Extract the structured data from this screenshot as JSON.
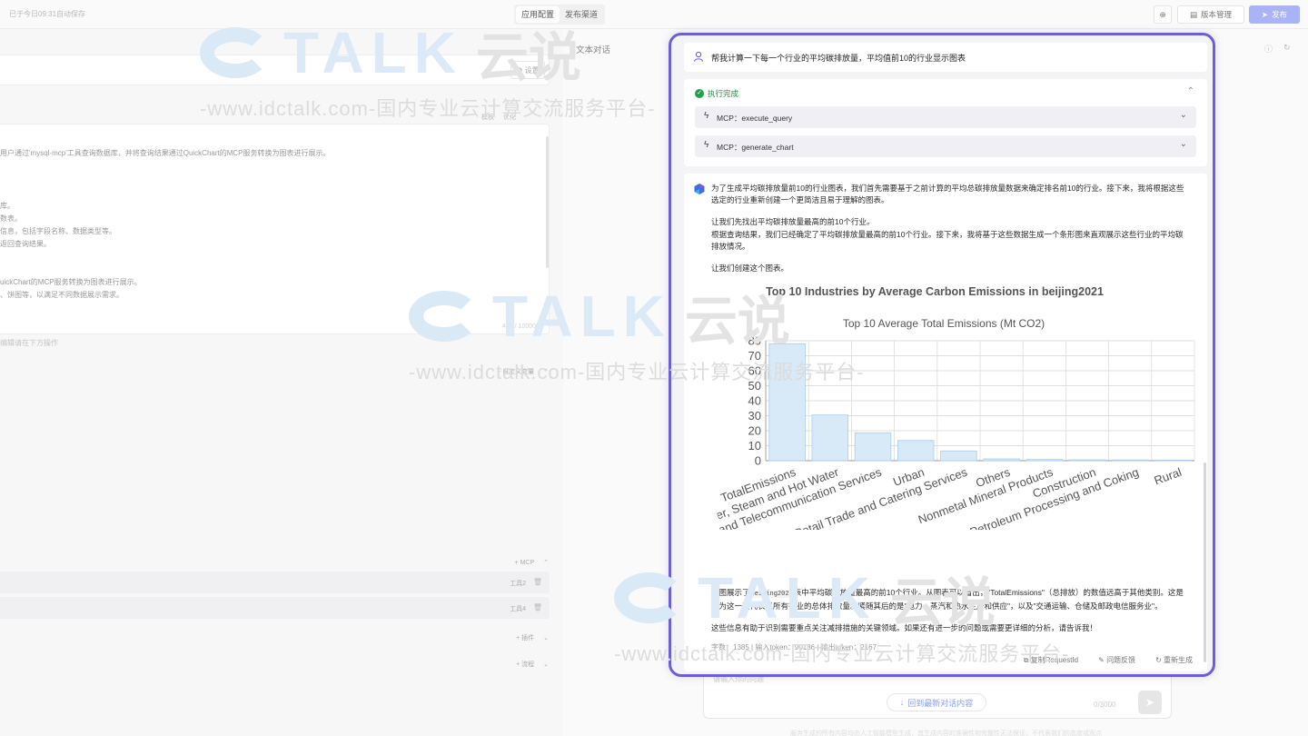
{
  "topbar": {
    "saved_text": "已于今日09:31自动保存",
    "tabs": [
      "应用配置",
      "发布渠道"
    ],
    "version_label": "版本管理",
    "publish_label": "发布"
  },
  "left_panel": {
    "settings_label": "设置",
    "tool_labels": [
      "模板",
      "优化"
    ],
    "prompt_lines": [
      "用户通过'mysql-mcp'工具查询数据库，并将查询结果通过QuickChart的MCP服务转换为图表进行展示。",
      "库。",
      "数表。",
      "信息，包括字段名称、数据类型等。",
      "返回查询结果。",
      "uickChart的MCP服务转换为图表进行展示。",
      "、饼图等，以满足不同数据展示需求。"
    ],
    "char_count": "494 / 10000",
    "hint": "编辑请在下方操作",
    "variables_label": "自定义变量",
    "mcp_label": "MCP",
    "tools": [
      "工具2",
      "工具4"
    ],
    "plugins_label": "插件",
    "workflow_label": "流程"
  },
  "right": {
    "tab_label": "文本对话",
    "input_placeholder": "请输入你的问题",
    "latest_btn": "回到最新对话内容",
    "char_count": "0/3000",
    "disclaimer": "服务生成的所有内容均由人工智能模型生成，其生成内容的准确性和完整性无法保证，不代表我们的态度或观点"
  },
  "chat": {
    "user_message": "帮我计算一下每一个行业的平均碳排放量，平均值前10的行业显示图表",
    "status": "执行完成",
    "mcp_calls": [
      {
        "label": "MCP：execute_query"
      },
      {
        "label": "MCP：generate_chart"
      }
    ],
    "intro": [
      "为了生成平均碳排放量前10的行业图表，我们首先需要基于之前计算的平均总碳排放量数据来确定排名前10的行业。接下来，我将根据这些",
      "选定的行业重新创建一个更简洁且易于理解的图表。"
    ],
    "step1": "让我们先找出平均碳排放量最高的前10个行业。",
    "step2": [
      "根据查询结果，我们已经确定了平均碳排放量最高的前10个行业。接下来，我将基于这些数据生成一个条形图来直观展示这些行业的平均碳",
      "排放情况。"
    ],
    "step3": "让我们创建这个图表。",
    "conclusion1_pre": "上图展示了",
    "conclusion1_code": "beijing2021",
    "conclusion1_post": "表中平均碳排放量最高的前10个行业。从图表可以看出，\"TotalEmissions\"（总排放）的数值远高于其他类别。这是",
    "conclusion1_line2": "因为这一项代表了所有行业的总体排放量。紧随其后的是\"电力、蒸汽和热水生产和供应\"，以及\"交通运输、仓储及邮政电信服务业\"。",
    "conclusion2": "这些信息有助于识别需要重点关注减排措施的关键领域。如果还有进一步的问题或需要更详细的分析，请告诉我！",
    "stats": "字数：1385 | 输入token：90186 | 输出token：2167",
    "actions": [
      "复制RequestId",
      "问题反馈",
      "重新生成"
    ]
  },
  "chart_data": {
    "type": "bar",
    "title": "Top 10 Industries by Average Carbon Emissions in beijing2021",
    "subtitle": "Top 10 Average Total Emissions (Mt CO2)",
    "categories": [
      "TotalEmissions",
      "Power, Steam and Hot Water",
      "Transport and Telecommunication Services",
      "Urban",
      "Wholesale, Retail Trade and Catering Services",
      "Others",
      "Nonmetal Mineral Products",
      "Construction",
      "Petroleum Processing and Coking",
      "Rural"
    ],
    "visible_labels": [
      "TotalEmissions",
      "ver, Steam and Hot Water",
      "and Telecommunication Services",
      "Urban",
      "Wholesale, Retail Trade and Catering Services",
      "Others",
      "Nonmetal Mineral Products",
      "Construction",
      "Petroleum Processing and Coking",
      "Rural"
    ],
    "values": [
      78,
      30.5,
      18.5,
      13.5,
      6.5,
      1.2,
      0.8,
      0.6,
      0.5,
      0.4
    ],
    "ylim": [
      0,
      80
    ],
    "yticks": [
      0,
      10,
      20,
      30,
      40,
      50,
      60,
      70,
      80
    ],
    "bar_color": "#d8e9f7",
    "bar_border": "#a9cdec",
    "grid": true,
    "legend": "none"
  },
  "colors": {
    "accent": "#6d5ed6",
    "success": "#22a14b",
    "publish": "#a9b3f5"
  },
  "watermark": {
    "brand": "TALK",
    "cn": "云说",
    "url": "-www.idctalk.com-国内专业云计算交流服务平台-"
  }
}
